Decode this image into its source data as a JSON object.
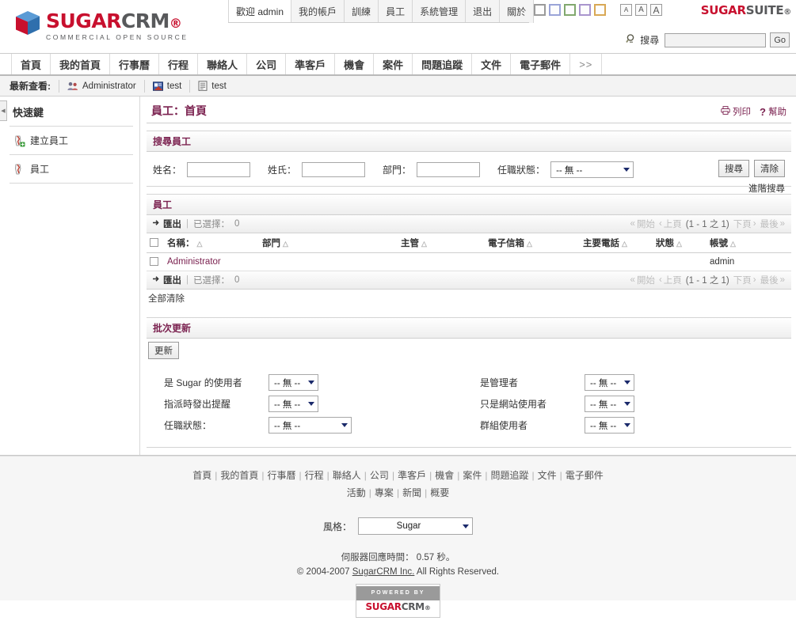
{
  "header": {
    "logo": {
      "sugar": "SUGAR",
      "crm": "CRM",
      "dot": "®",
      "tagline": "COMMERCIAL OPEN SOURCE"
    },
    "suite_logo": {
      "sugar": "SUGAR",
      "suite": "SUITE",
      "dot": "®"
    },
    "top_tabs": [
      {
        "label": "歡迎 admin",
        "name": "welcome-admin",
        "active": true
      },
      {
        "label": "我的帳戶",
        "name": "my-account"
      },
      {
        "label": "訓練",
        "name": "training"
      },
      {
        "label": "員工",
        "name": "employees"
      },
      {
        "label": "系統管理",
        "name": "admin"
      },
      {
        "label": "退出",
        "name": "logout"
      },
      {
        "label": "關於",
        "name": "about"
      }
    ],
    "swatches": [
      {
        "name": "theme-swatch-gray",
        "color": "#9a9a9a"
      },
      {
        "name": "theme-swatch-blue",
        "color": "#9aa4d8"
      },
      {
        "name": "theme-swatch-green",
        "color": "#81a86e"
      },
      {
        "name": "theme-swatch-purple",
        "color": "#a995cd"
      },
      {
        "name": "theme-swatch-orange",
        "color": "#d9a855"
      }
    ],
    "font_buttons": [
      "A",
      "A",
      "A"
    ],
    "search": {
      "label": "搜尋",
      "value": "",
      "placeholder": "",
      "go_label": "Go"
    }
  },
  "module_nav": [
    {
      "label": "首頁",
      "name": "home"
    },
    {
      "label": "我的首頁",
      "name": "my-home"
    },
    {
      "label": "行事曆",
      "name": "calendar"
    },
    {
      "label": "行程",
      "name": "activities"
    },
    {
      "label": "聯絡人",
      "name": "contacts"
    },
    {
      "label": "公司",
      "name": "accounts"
    },
    {
      "label": "準客戶",
      "name": "leads"
    },
    {
      "label": "機會",
      "name": "opportunities"
    },
    {
      "label": "案件",
      "name": "cases"
    },
    {
      "label": "問題追蹤",
      "name": "bug-tracker"
    },
    {
      "label": "文件",
      "name": "documents"
    },
    {
      "label": "電子郵件",
      "name": "emails"
    },
    {
      "label": ">>",
      "name": "more"
    }
  ],
  "recent": {
    "label": "最新查看:",
    "items": [
      {
        "label": "Administrator",
        "icon": "users-icon"
      },
      {
        "label": "test",
        "icon": "contact-icon"
      },
      {
        "label": "test",
        "icon": "document-icon"
      }
    ]
  },
  "sidebar": {
    "title": "快速鍵",
    "items": [
      {
        "label": "建立員工",
        "icon": "create-employee-icon"
      },
      {
        "label": "員工",
        "icon": "employee-icon"
      }
    ]
  },
  "page": {
    "title": "員工：首頁",
    "actions": [
      {
        "label": "列印",
        "icon": "printer-icon",
        "name": "print-link"
      },
      {
        "label": "幫助",
        "icon": "question-icon",
        "name": "help-link"
      }
    ]
  },
  "search_panel": {
    "heading": "搜尋員工",
    "fields": [
      {
        "label": "姓名：",
        "value": "",
        "name": "first-name-input"
      },
      {
        "label": "姓氏：",
        "value": "",
        "name": "last-name-input"
      },
      {
        "label": "部門：",
        "value": "",
        "name": "department-input"
      }
    ],
    "status": {
      "label": "任職狀態：",
      "value": "-- 無 --"
    },
    "search_button": "搜尋",
    "clear_button": "清除",
    "advanced_link": "進階搜尋"
  },
  "list_panel": {
    "heading": "員工",
    "toolbar": {
      "export_label": "匯出",
      "separator": "|",
      "selected_label": "已選擇：",
      "selected_count": "0",
      "pagination": {
        "start": "開始",
        "prev": "上頁",
        "range": "(1 - 1 之 1)",
        "next": "下頁",
        "last": "最後"
      }
    },
    "columns": [
      {
        "label": "名稱：",
        "sortable": true
      },
      {
        "label": "部門",
        "sortable": true
      },
      {
        "label": "主管",
        "sortable": true
      },
      {
        "label": "電子信箱",
        "sortable": true
      },
      {
        "label": "主要電話",
        "sortable": true
      },
      {
        "label": "狀態",
        "sortable": true
      },
      {
        "label": "帳號",
        "sortable": true
      }
    ],
    "rows": [
      {
        "name": "Administrator",
        "department": "",
        "supervisor": "",
        "email": "",
        "phone": "",
        "status": "",
        "username": "admin"
      }
    ],
    "clear_all": "全部清除"
  },
  "mass_update": {
    "heading": "批次更新",
    "update_button": "更新",
    "rows": [
      {
        "left": {
          "label": "是 Sugar 的使用者",
          "value": "-- 無 --",
          "name": "is-sugar-user-select",
          "width": "w63"
        },
        "right": {
          "label": "是管理者",
          "value": "-- 無 --",
          "name": "is-admin-select",
          "width": "w63"
        }
      },
      {
        "left": {
          "label": "指派時發出提醒",
          "value": "-- 無 --",
          "name": "notify-on-assign-select",
          "width": "w63"
        },
        "right": {
          "label": "只是網站使用者",
          "value": "-- 無 --",
          "name": "portal-only-select",
          "width": "w63"
        }
      },
      {
        "left": {
          "label": "任職狀態：",
          "value": "-- 無 --",
          "name": "employment-status-select",
          "width": "w105"
        },
        "right": {
          "label": "群組使用者",
          "value": "-- 無 --",
          "name": "group-user-select",
          "width": "w63"
        }
      }
    ]
  },
  "footer": {
    "links_row1": [
      "首頁",
      "我的首頁",
      "行事曆",
      "行程",
      "聯絡人",
      "公司",
      "準客戶",
      "機會",
      "案件",
      "問題追蹤",
      "文件",
      "電子郵件"
    ],
    "links_row2": [
      "活動",
      "專案",
      "新聞",
      "概要"
    ],
    "theme_label": "風格：",
    "theme_value": "Sugar",
    "server_time": "伺服器回應時間： 0.57 秒。",
    "copyright_pre": "© 2004-2007 ",
    "copyright_link": "SugarCRM Inc.",
    "copyright_post": " All Rights Reserved.",
    "powered_top": "POWERED BY",
    "powered_sugar": "SUGAR",
    "powered_crm": "CRM",
    "powered_dot": "®"
  },
  "colors": {
    "brand_red": "#c8102e",
    "brand_gray": "#58595b",
    "accent_maroon": "#7b2250"
  }
}
